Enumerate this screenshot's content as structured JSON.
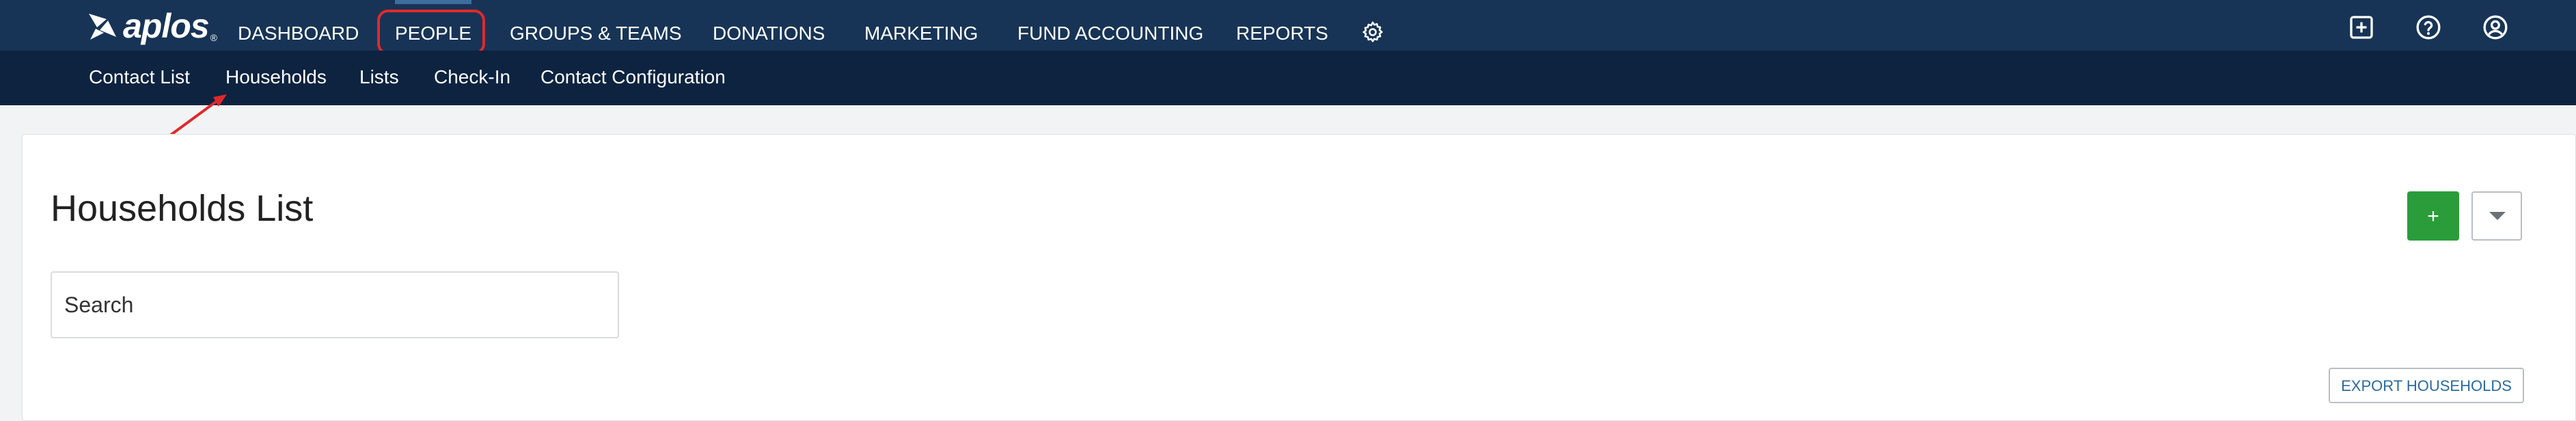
{
  "app": {
    "logo_text": "aplos",
    "logo_mark": "®"
  },
  "topnav": {
    "items": [
      {
        "label": "DASHBOARD"
      },
      {
        "label": "PEOPLE"
      },
      {
        "label": "GROUPS & TEAMS"
      },
      {
        "label": "DONATIONS"
      },
      {
        "label": "MARKETING"
      },
      {
        "label": "FUND ACCOUNTING"
      },
      {
        "label": "REPORTS"
      }
    ],
    "active": "PEOPLE",
    "right_icons": [
      "plus-square-icon",
      "help-circle-icon",
      "user-circle-icon"
    ]
  },
  "subnav": {
    "items": [
      {
        "label": "Contact List"
      },
      {
        "label": "Households"
      },
      {
        "label": "Lists"
      },
      {
        "label": "Check-In"
      },
      {
        "label": "Contact Configuration"
      }
    ]
  },
  "main": {
    "title": "Households List",
    "search": {
      "placeholder": "Search",
      "value": ""
    },
    "add_label": "+",
    "export_label": "EXPORT HOUSEHOLDS"
  },
  "colors": {
    "topnav_bg": "#173456",
    "subnav_bg": "#0d2340",
    "add_button": "#2b9c3a",
    "highlight": "#e0292b"
  }
}
